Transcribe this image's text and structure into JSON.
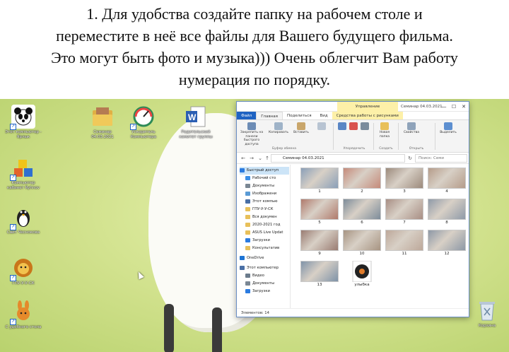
{
  "slide": {
    "caption_lines": [
      "1. Для удобства создайте папку на рабочем столе и",
      "переместите в неё все файлы для Вашего будущего фильма.",
      "Это могут быть фото и музыка))) Очень облегчит Вам работу",
      "нумерация по порядку."
    ]
  },
  "desktop": {
    "icons": [
      {
        "label": "Этот компьютер - Ярлык",
        "icon": "panda-icon",
        "color": "#1d1d1d"
      },
      {
        "label": "Компьютер кабинет Ryhnov",
        "icon": "blocks-icon",
        "color": "#e4642a"
      },
      {
        "label": "Сайт Чеснокова",
        "icon": "penguin-icon",
        "color": "#222222"
      },
      {
        "label": "ГПУ-У-У-СК",
        "icon": "lion-icon",
        "color": "#d98f1f"
      },
      {
        "label": "С удобного стола",
        "icon": "bunny-icon",
        "color": "#e58a2b"
      },
      {
        "label": "Семинар 04.03.2021",
        "icon": "folder-icon",
        "color": "#e0b044"
      },
      {
        "label": "Ускоритель Компьютера",
        "icon": "gauge-icon",
        "color": "#2e8b57"
      },
      {
        "label": "Родительский комитет группы",
        "icon": "word-doc-icon",
        "color": "#2b5fb3"
      },
      {
        "label": "Корзина",
        "icon": "recycle-bin-icon",
        "color": "#9fb3c8"
      }
    ]
  },
  "explorer": {
    "context_tab": "Управление",
    "title": "Семинар 04.03.2021",
    "controls": {
      "minimize": "—",
      "maximize": "☐",
      "close": "✕"
    },
    "tabs": [
      "Файл",
      "Главная",
      "Поделиться",
      "Вид",
      "Средства работы с рисунками"
    ],
    "ribbon": {
      "pin": "Закрепить на панели быстрого доступа",
      "copy": "Копировать",
      "paste": "Вставить",
      "new_folder": "Новая папка",
      "properties": "Свойства",
      "select": "Выделить",
      "groups": [
        "Буфер обмена",
        "Упорядочить",
        "Создать",
        "Открыть"
      ]
    },
    "address": {
      "path": "Семинар 04.03.2021",
      "search_placeholder": "Поиск: Семи"
    },
    "nav_items": [
      {
        "label": "Быстрый доступ",
        "icon": "star-icon",
        "color": "#2b7be0",
        "selected": true
      },
      {
        "label": "Рабочий сто",
        "icon": "desktop-icon",
        "color": "#3a8ee6"
      },
      {
        "label": "Документы",
        "icon": "documents-icon",
        "color": "#7a8794"
      },
      {
        "label": "Изображени",
        "icon": "pictures-icon",
        "color": "#5a9bd5"
      },
      {
        "label": "Этот компью",
        "icon": "computer-icon",
        "color": "#4a6fa5"
      },
      {
        "label": "ГПУ-У-У-СК",
        "icon": "folder-icon",
        "color": "#e8c05a"
      },
      {
        "label": "Вся докумен",
        "icon": "folder-icon",
        "color": "#e8c05a"
      },
      {
        "label": "2020-2021 год",
        "icon": "folder-icon",
        "color": "#e8c05a"
      },
      {
        "label": "ASUS Live Updat",
        "icon": "folder-icon",
        "color": "#e8c05a"
      },
      {
        "label": "Загрузки",
        "icon": "downloads-icon",
        "color": "#2b7be0"
      },
      {
        "label": "Консультатив",
        "icon": "folder-icon",
        "color": "#e8c05a"
      },
      {
        "label": "OneDrive",
        "icon": "onedrive-icon",
        "color": "#1e74d4"
      },
      {
        "label": "Этот компьютер",
        "icon": "computer-icon",
        "color": "#4a6fa5"
      },
      {
        "label": "Видео",
        "icon": "video-icon",
        "color": "#6b7b8c"
      },
      {
        "label": "Документы",
        "icon": "documents-icon",
        "color": "#7a8794"
      },
      {
        "label": "Загрузки",
        "icon": "downloads-icon",
        "color": "#2b7be0"
      }
    ],
    "files": [
      {
        "name": "1",
        "tone": "#8a9fb8"
      },
      {
        "name": "2",
        "tone": "#c58a7a"
      },
      {
        "name": "3",
        "tone": "#9c8a7c"
      },
      {
        "name": "4",
        "tone": "#b59c8a"
      },
      {
        "name": "5",
        "tone": "#b07a6c"
      },
      {
        "name": "6",
        "tone": "#7d8c9a"
      },
      {
        "name": "7",
        "tone": "#a88e84"
      },
      {
        "name": "8",
        "tone": "#8f9aa8"
      },
      {
        "name": "9",
        "tone": "#9a7c72"
      },
      {
        "name": "10",
        "tone": "#a79482"
      },
      {
        "name": "11",
        "tone": "#bda89a"
      },
      {
        "name": "12",
        "tone": "#8d98a6"
      },
      {
        "name": "13",
        "tone": "#7f93a8"
      },
      {
        "name": "улыбка",
        "tone": "#e07b2a",
        "type": "music-file-icon"
      }
    ],
    "status": "Элементов: 14"
  }
}
